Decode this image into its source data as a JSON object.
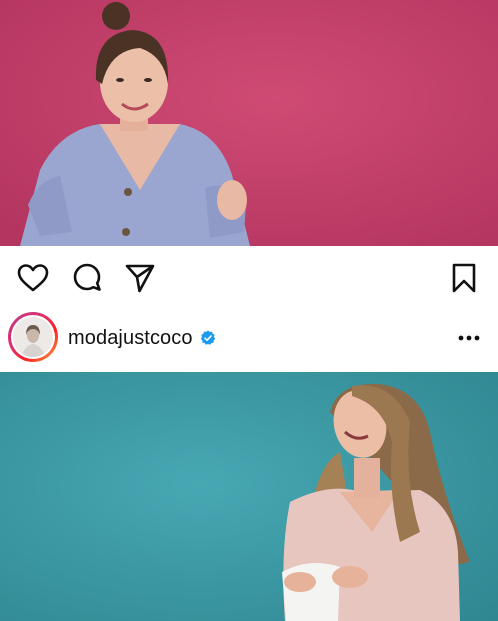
{
  "post": {
    "account": {
      "username": "modajustcoco",
      "verified": true
    },
    "actions": {
      "like_icon": "heart-icon",
      "comment_icon": "comment-icon",
      "share_icon": "send-icon",
      "save_icon": "bookmark-icon",
      "more_icon": "more-options-icon"
    }
  },
  "colors": {
    "top_photo_background": "#c2406a",
    "bottom_photo_background": "#3a9aa6",
    "verified_badge": "#1d9bf0",
    "text": "#111111"
  }
}
